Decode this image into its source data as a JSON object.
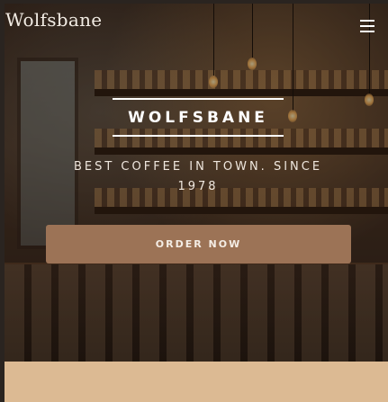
{
  "header": {
    "logo_text": "Wolfsbane",
    "menu_icon": "hamburger-menu-icon"
  },
  "hero": {
    "title": "WOLFSBANE",
    "tagline": "BEST COFFEE IN TOWN. SINCE 1978",
    "cta_label": "ORDER NOW"
  },
  "colors": {
    "accent_button": "#9c7356",
    "lower_band": "#dcba93",
    "text": "#ffffff"
  }
}
